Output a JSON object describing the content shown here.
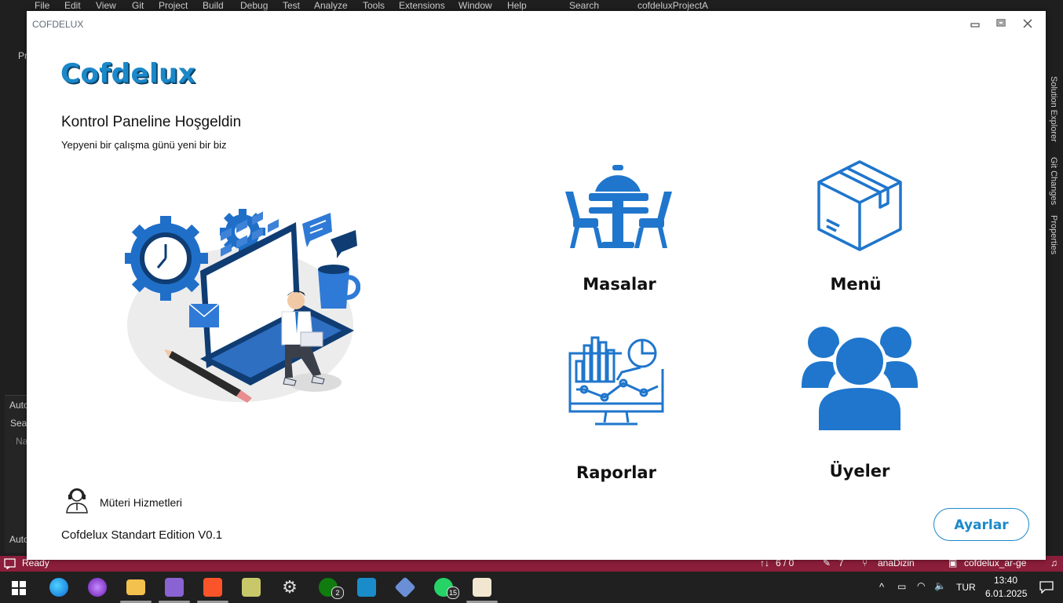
{
  "window": {
    "title": "COFDELUX"
  },
  "app": {
    "logo": "Cofdelux",
    "welcome": "Kontrol Paneline Hoşgeldin",
    "tagline": "Yepyeni bir çalışma günü yeni bir biz",
    "support_label": "Müteri Hizmetleri",
    "edition": "Cofdelux Standart Edition V0.1",
    "settings_label": "Ayarlar"
  },
  "tiles": [
    {
      "label": "Masalar",
      "icon": "dining-table-icon"
    },
    {
      "label": "Menü",
      "icon": "box-icon"
    },
    {
      "label": "Raporlar",
      "icon": "report-monitor-icon"
    },
    {
      "label": "Üyeler",
      "icon": "users-icon"
    }
  ],
  "ide": {
    "menu": [
      "File",
      "Edit",
      "View",
      "Git",
      "Project",
      "Build",
      "Debug",
      "Test",
      "Analyze",
      "Tools",
      "Extensions",
      "Window",
      "Help"
    ],
    "search": "Search",
    "project": "cofdeluxProjectA",
    "side_tabs": [
      "Solution Explorer",
      "Git Changes",
      "Properties"
    ],
    "pane_labels": [
      "Auto",
      "Sea",
      "Na",
      "Auto"
    ],
    "left_text": "Pr",
    "status": {
      "ready": "Ready",
      "lines": "6 / 0",
      "pencil": "7",
      "branch": "anaDizin",
      "repo": "cofdelux_ar-ge"
    }
  },
  "taskbar": {
    "badges": {
      "xbox": "2",
      "whatsapp": "15"
    },
    "language": "TUR",
    "time": "13:40",
    "date": "6.01.2025"
  },
  "colors": {
    "accent": "#1b88c9",
    "status_bar": "#8b1e3a",
    "taskbar": "#202020"
  }
}
